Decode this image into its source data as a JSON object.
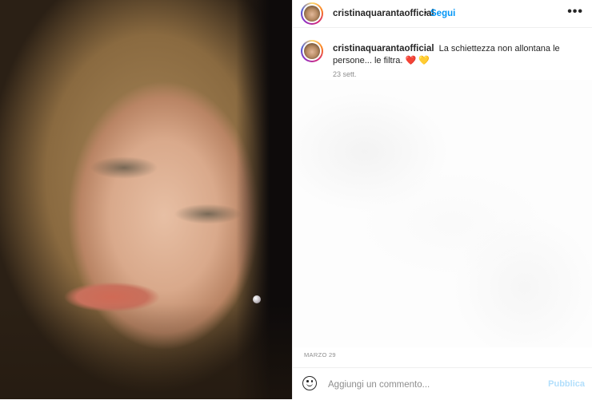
{
  "post": {
    "username": "cristinaquarantaofficial",
    "follow_label": "Segui",
    "separator": "•",
    "more_label": "•••"
  },
  "caption": {
    "username": "cristinaquarantaofficial",
    "text": "La schiettezza non allontana le persone... le filtra.",
    "emoji_red_heart": "❤️",
    "emoji_yellow_heart": "💛",
    "time": "23 sett."
  },
  "footer": {
    "date": "MARZO 29"
  },
  "comment": {
    "placeholder": "Aggiungi un commento...",
    "publish_label": "Pubblica"
  },
  "colors": {
    "link_blue": "#0095f6",
    "publish_disabled": "#b2dffc"
  },
  "icons": {
    "emoji": "smiley-icon",
    "more": "more-options-icon"
  }
}
